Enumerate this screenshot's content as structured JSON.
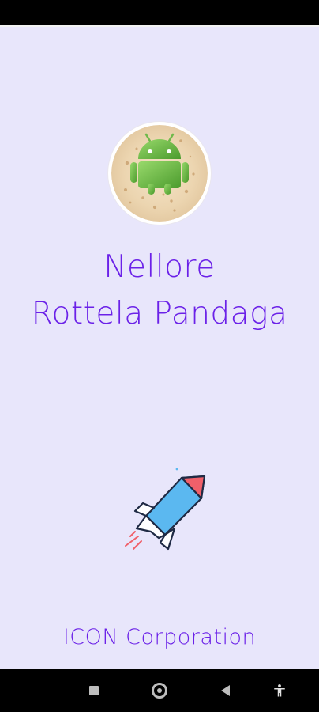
{
  "app": {
    "title_line1": "Nellore",
    "title_line2": "Rottela Pandaga",
    "company": "ICON Corporation"
  },
  "icons": {
    "logo": "android-on-flatbread-icon",
    "rocket": "rocket-icon",
    "recents": "square-icon",
    "home": "home-circle-icon",
    "back": "back-triangle-icon",
    "accessibility": "accessibility-icon"
  },
  "colors": {
    "background": "#e8e6fb",
    "accent": "#6b21e8",
    "navbar": "#000000",
    "android_green": "#78c257",
    "rocket_blue": "#5bb8f0",
    "rocket_nose": "#f0606a"
  }
}
